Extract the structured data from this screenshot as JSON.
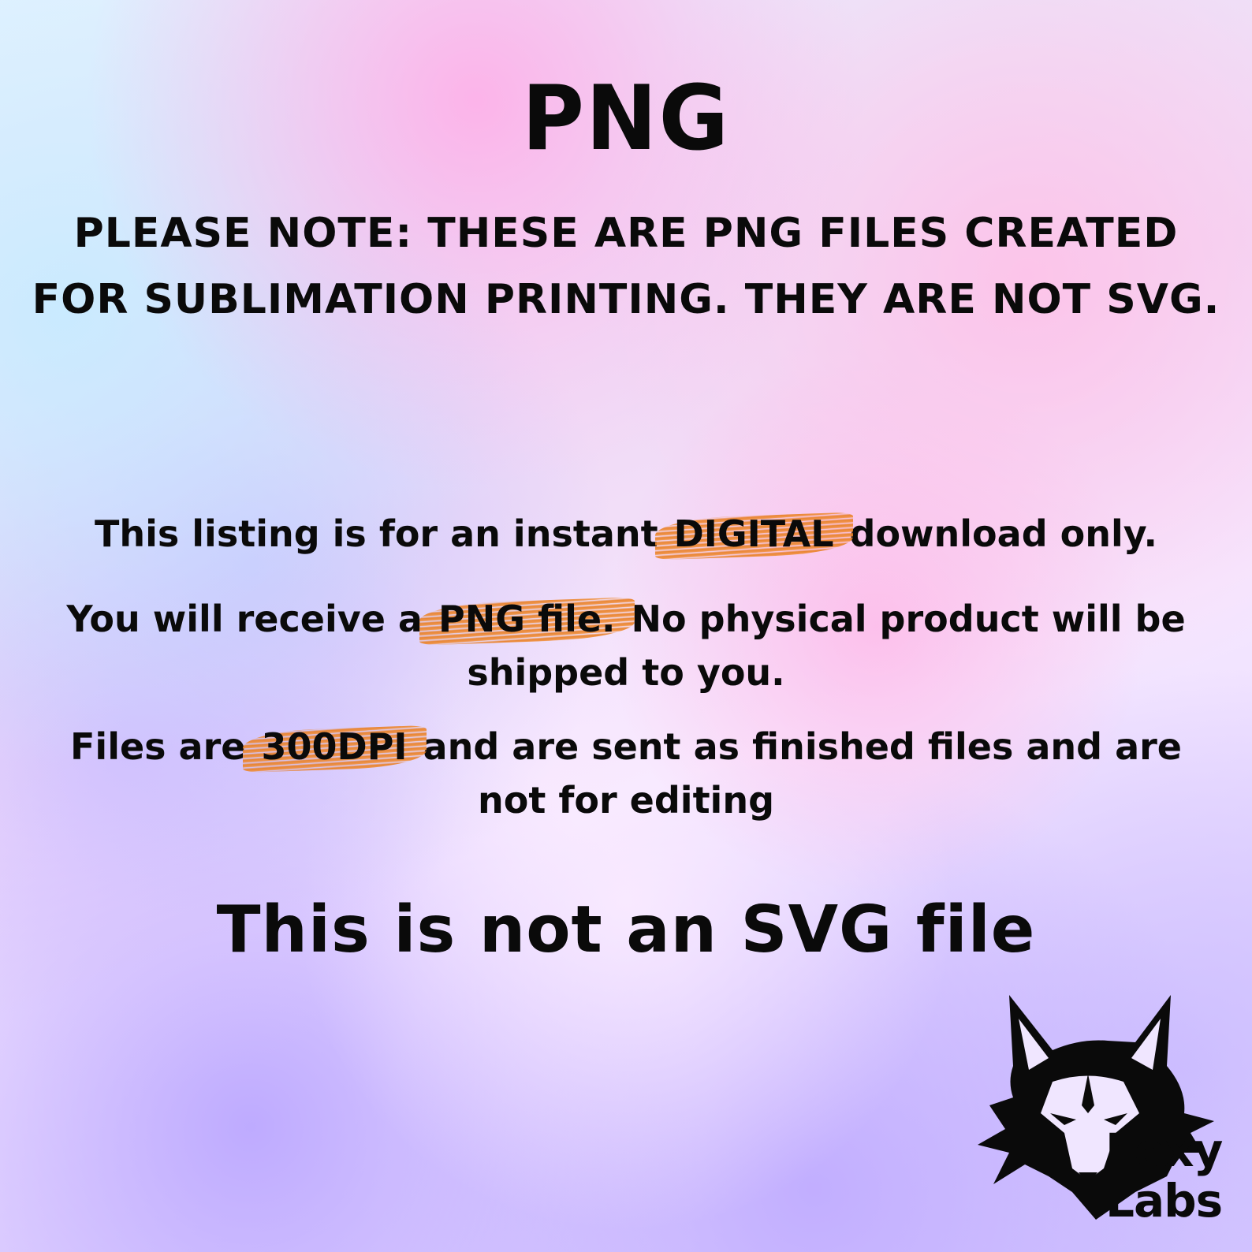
{
  "title": "PNG",
  "notice": {
    "line1": "PLEASE NOTE: THESE ARE PNG FILES CREATED",
    "line2": "FOR SUBLIMATION PRINTING. THEY ARE NOT SVG."
  },
  "info": {
    "line1_before": "This listing is for an instant ",
    "line1_highlight": "DIGITAL",
    "line1_after": " download only.",
    "line2_before": "You will receive a ",
    "line2_highlight": "PNG file.",
    "line2_after": " No physical product will be",
    "line2_cont": "shipped to you.",
    "line3_before": "Files are ",
    "line3_highlight": "300DPI",
    "line3_after": " and are sent as finished files and are",
    "line3_cont": "not for editing"
  },
  "footer_title": "This is not an SVG file",
  "brand": {
    "logo_icon": "fox-head-icon",
    "line1": "Foxy",
    "line2": "Labs"
  },
  "colors": {
    "text": "#0a0a0a",
    "highlight": "#e8802a"
  }
}
